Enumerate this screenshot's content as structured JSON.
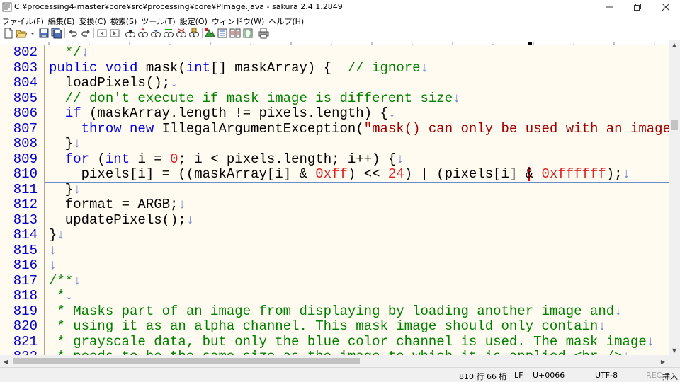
{
  "window": {
    "title": "C:¥processing4-master¥core¥src¥processing¥core¥PImage.java - sakura 2.4.1.2849"
  },
  "menu": [
    "ファイル(F)",
    "編集(E)",
    "変換(C)",
    "検索(S)",
    "ツール(T)",
    "設定(O)",
    "ウィンドウ(W)",
    "ヘルプ(H)"
  ],
  "toolbar_icons": [
    "new-file-icon",
    "open-folder-icon",
    "save-icon",
    "save-all-icon",
    "undo-icon",
    "redo-icon",
    "jump-back-icon",
    "jump-forward-icon",
    "search-icon",
    "search-prev-icon",
    "search-next-icon",
    "replace-icon",
    "clear-mark-icon",
    "grep-icon",
    "jump-to-icon",
    "outline-icon",
    "compare-icon",
    "print-icon"
  ],
  "editor": {
    "lines": [
      {
        "num": "802",
        "code": [
          {
            "t": "  */",
            "c": "cm"
          },
          {
            "t": "↓",
            "c": "nl"
          }
        ]
      },
      {
        "num": "803",
        "code": [
          {
            "t": "public void",
            "c": "kw"
          },
          {
            "t": " mask(",
            "c": ""
          },
          {
            "t": "int",
            "c": "kw"
          },
          {
            "t": "[] maskArray) {  ",
            "c": ""
          },
          {
            "t": "// ignore",
            "c": "cm"
          },
          {
            "t": "↓",
            "c": "nl"
          }
        ]
      },
      {
        "num": "804",
        "code": [
          {
            "t": "  loadPixels();",
            "c": ""
          },
          {
            "t": "↓",
            "c": "nl"
          }
        ]
      },
      {
        "num": "805",
        "code": [
          {
            "t": "  // don't execute if mask image is different size",
            "c": "cm"
          },
          {
            "t": "↓",
            "c": "nl"
          }
        ]
      },
      {
        "num": "806",
        "code": [
          {
            "t": "  ",
            "c": ""
          },
          {
            "t": "if",
            "c": "kw"
          },
          {
            "t": " (maskArray.length != pixels.length) {",
            "c": ""
          },
          {
            "t": "↓",
            "c": "nl"
          }
        ]
      },
      {
        "num": "807",
        "code": [
          {
            "t": "    ",
            "c": ""
          },
          {
            "t": "throw new",
            "c": "kw"
          },
          {
            "t": " IllegalArgumentException(",
            "c": ""
          },
          {
            "t": "\"mask() can only be used with an image that",
            "c": "st"
          }
        ]
      },
      {
        "num": "808",
        "code": [
          {
            "t": "  }",
            "c": ""
          },
          {
            "t": "↓",
            "c": "nl"
          }
        ]
      },
      {
        "num": "809",
        "code": [
          {
            "t": "  ",
            "c": ""
          },
          {
            "t": "for",
            "c": "kw"
          },
          {
            "t": " (",
            "c": ""
          },
          {
            "t": "int",
            "c": "kw"
          },
          {
            "t": " i = ",
            "c": ""
          },
          {
            "t": "0",
            "c": "nm"
          },
          {
            "t": "; i < pixels.length; i++) {",
            "c": ""
          },
          {
            "t": "↓",
            "c": "nl"
          }
        ]
      },
      {
        "num": "810",
        "code": [
          {
            "t": "    pixels[i] = ((maskArray[i] & ",
            "c": ""
          },
          {
            "t": "0xff",
            "c": "nm"
          },
          {
            "t": ") << ",
            "c": ""
          },
          {
            "t": "24",
            "c": "nm"
          },
          {
            "t": ") | (pixels[i] & ",
            "c": ""
          },
          {
            "t": "0xffffff",
            "c": "nm"
          },
          {
            "t": ");",
            "c": ""
          },
          {
            "t": "↓",
            "c": "nl"
          }
        ]
      },
      {
        "num": "811",
        "code": [
          {
            "t": "  }",
            "c": ""
          },
          {
            "t": "↓",
            "c": "nl"
          }
        ]
      },
      {
        "num": "812",
        "code": [
          {
            "t": "  format = ARGB;",
            "c": ""
          },
          {
            "t": "↓",
            "c": "nl"
          }
        ]
      },
      {
        "num": "813",
        "code": [
          {
            "t": "  updatePixels();",
            "c": ""
          },
          {
            "t": "↓",
            "c": "nl"
          }
        ]
      },
      {
        "num": "814",
        "code": [
          {
            "t": "}",
            "c": ""
          },
          {
            "t": "↓",
            "c": "nl"
          }
        ]
      },
      {
        "num": "815",
        "code": [
          {
            "t": "↓",
            "c": "nl"
          }
        ]
      },
      {
        "num": "816",
        "code": [
          {
            "t": "↓",
            "c": "nl"
          }
        ]
      },
      {
        "num": "817",
        "code": [
          {
            "t": "/**",
            "c": "cm"
          },
          {
            "t": "↓",
            "c": "nl"
          }
        ]
      },
      {
        "num": "818",
        "code": [
          {
            "t": " *",
            "c": "cm"
          },
          {
            "t": "↓",
            "c": "nl"
          }
        ]
      },
      {
        "num": "819",
        "code": [
          {
            "t": " * Masks part of an image from displaying by loading another image and",
            "c": "cm"
          },
          {
            "t": "↓",
            "c": "nl"
          }
        ]
      },
      {
        "num": "820",
        "code": [
          {
            "t": " * using it as an alpha channel. This mask image should only contain",
            "c": "cm"
          },
          {
            "t": "↓",
            "c": "nl"
          }
        ]
      },
      {
        "num": "821",
        "code": [
          {
            "t": " * grayscale data, but only the blue color channel is used. The mask image",
            "c": "cm"
          },
          {
            "t": "↓",
            "c": "nl"
          }
        ]
      },
      {
        "num": "822",
        "code": [
          {
            "t": " * needs to be the same size as the image to which it is applied.<br />",
            "c": "cm"
          },
          {
            "t": "↓",
            "c": "nl"
          }
        ]
      }
    ]
  },
  "status": {
    "position": "810 行   66 桁",
    "eol": "LF",
    "char_code": "U+0066",
    "encoding": "UTF-8",
    "rec": "REC",
    "mode": "挿入"
  }
}
